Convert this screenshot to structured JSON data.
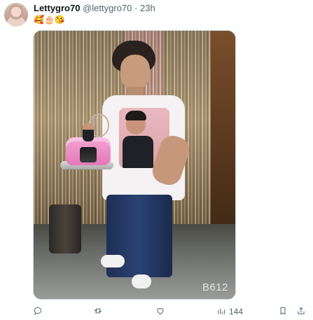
{
  "tweet": {
    "display_name": "Lettygro70",
    "handle": "@lettygro70",
    "separator": "·",
    "timestamp": "23h",
    "text": "🥰🎂😘"
  },
  "media": {
    "watermark": "B612"
  },
  "actions": {
    "reply_icon": "comment-icon",
    "retweet_icon": "retweet-icon",
    "like_icon": "heart-icon",
    "views_icon": "views-icon",
    "views_count": "144",
    "bookmark_icon": "bookmark-icon",
    "share_icon": "share-icon"
  }
}
